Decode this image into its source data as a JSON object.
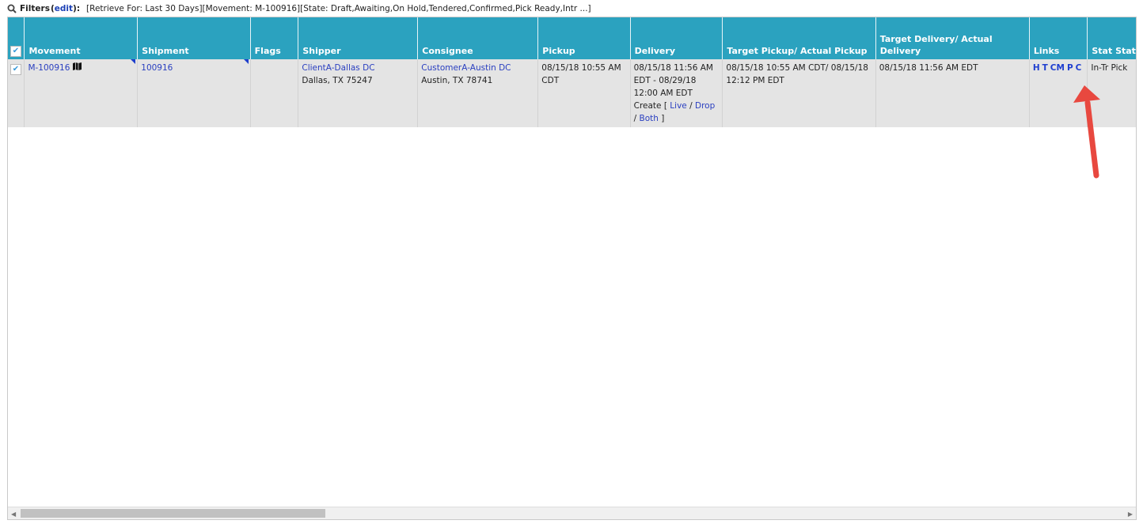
{
  "filters": {
    "label": "Filters",
    "edit": "edit",
    "open_paren": "(",
    "close_paren": "):",
    "summary": "[Retrieve For: Last 30 Days][Movement: M-100916][State: Draft,Awaiting,On Hold,Tendered,Confirmed,Pick Ready,Intr ...]"
  },
  "columns": [
    "Movement",
    "Shipment",
    "Flags",
    "Shipper",
    "Consignee",
    "Pickup",
    "Delivery",
    "Target Pickup/ Actual Pickup",
    "Target Delivery/ Actual Delivery",
    "Links",
    "Stat Stat"
  ],
  "row": {
    "checked": true,
    "movement": "M-100916",
    "shipment": "100916",
    "flags": "",
    "shipper_name": "ClientA-Dallas DC",
    "shipper_addr": "Dallas, TX 75247",
    "consignee_name": "CustomerA-Austin DC",
    "consignee_addr": "Austin, TX 78741",
    "pickup": "08/15/18 10:55 AM CDT",
    "delivery": "08/15/18 11:56 AM EDT - 08/29/18 12:00 AM EDT",
    "create": {
      "label": "Create [",
      "live": "Live",
      "sep1": "/",
      "drop": "Drop",
      "sep2": "/",
      "both": "Both",
      "end": "]"
    },
    "target_pickup": "08/15/18 10:55 AM CDT/ 08/15/18 12:12 PM EDT",
    "target_delivery": "08/15/18 11:56 AM EDT",
    "links": [
      "H",
      "T",
      "CM",
      "P",
      "C"
    ],
    "status": "In-Tr Pick"
  },
  "colors": {
    "header": "#2ba2bf",
    "row": "#e4e4e4",
    "link": "#2a3fc0",
    "arrow": "#e8483f"
  }
}
